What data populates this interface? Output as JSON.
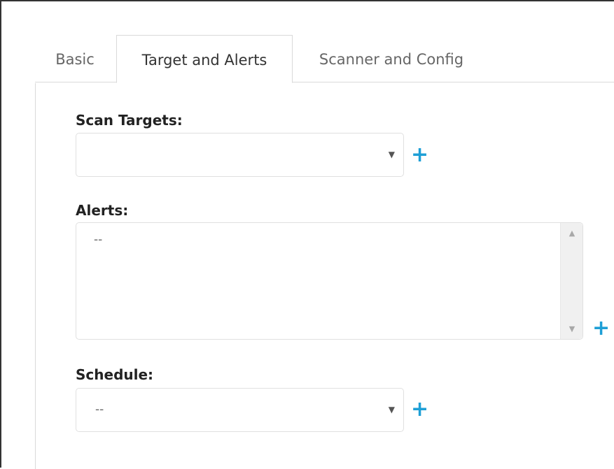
{
  "tabs": [
    {
      "label": "Basic",
      "active": false
    },
    {
      "label": "Target and Alerts",
      "active": true
    },
    {
      "label": "Scanner and Config",
      "active": false
    }
  ],
  "form": {
    "scan_targets": {
      "label": "Scan Targets:",
      "value": ""
    },
    "alerts": {
      "label": "Alerts:",
      "value": "--"
    },
    "schedule": {
      "label": "Schedule:",
      "value": "--"
    }
  },
  "glyphs": {
    "caret": "▼",
    "plus": "+",
    "scroll_up": "▲",
    "scroll_down": "▼"
  },
  "colors": {
    "accent": "#1e9fd6",
    "border": "#d9d9d9",
    "text": "#222222",
    "muted": "#666666"
  }
}
